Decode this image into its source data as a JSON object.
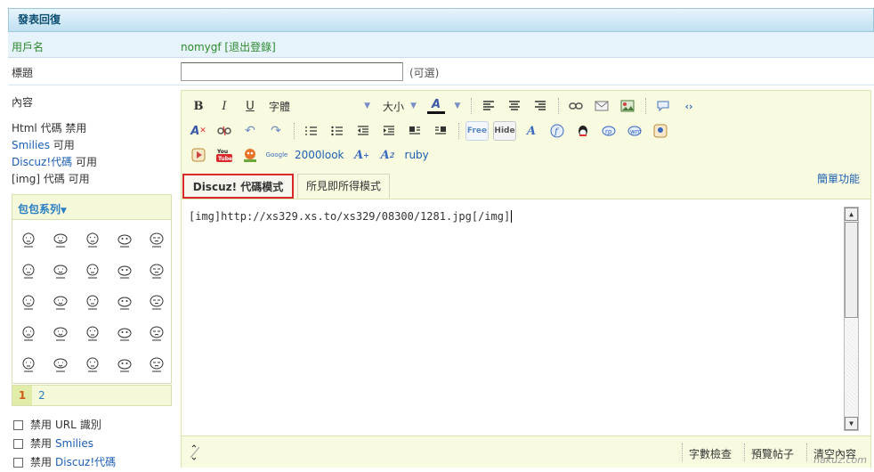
{
  "header": {
    "title": "發表回復"
  },
  "user_row": {
    "label": "用戶名",
    "username": "nomygf",
    "logout": "[退出登錄]"
  },
  "title_row": {
    "label": "標題",
    "input_value": "",
    "optional": "(可選)"
  },
  "content_row": {
    "label": "內容",
    "codes": [
      {
        "name": "Html",
        "text": " 代碼 禁用"
      },
      {
        "name": "Smilies",
        "text": " 可用"
      },
      {
        "name": "Discuz!代碼",
        "text": " 可用"
      },
      {
        "name": "[img]",
        "text": " 代碼 可用"
      }
    ]
  },
  "emoticons": {
    "header": "包包系列",
    "count": 25,
    "pages": [
      "1",
      "2"
    ],
    "active_page": "1"
  },
  "options": [
    {
      "pre": "禁用 ",
      "name": "URL",
      "post": " 識別"
    },
    {
      "pre": "禁用 ",
      "name": "Smilies",
      "post": ""
    },
    {
      "pre": "禁用 ",
      "name": "Discuz!代碼",
      "post": ""
    }
  ],
  "toolbar": {
    "bold": "B",
    "italic": "I",
    "underline": "U",
    "font_label": "字體",
    "size_label": "大小",
    "color_label": "A",
    "free_label": "Free",
    "hide_label": "Hide",
    "row3_2000look": "2000look",
    "row3_ruby": "ruby",
    "accent_color": "#d8282a"
  },
  "tabs": {
    "code_mode": "Discuz! 代碼模式",
    "wysiwyg_mode": "所見即所得模式",
    "simple_mode": "簡單功能"
  },
  "editor": {
    "content": "[img]http://xs329.xs.to/xs329/08300/1281.jpg[/img]"
  },
  "footer": {
    "word_check": "字數檢查",
    "preview": "預覽帖子",
    "clear": "清空內容",
    "watermark": "nakuz.com"
  }
}
